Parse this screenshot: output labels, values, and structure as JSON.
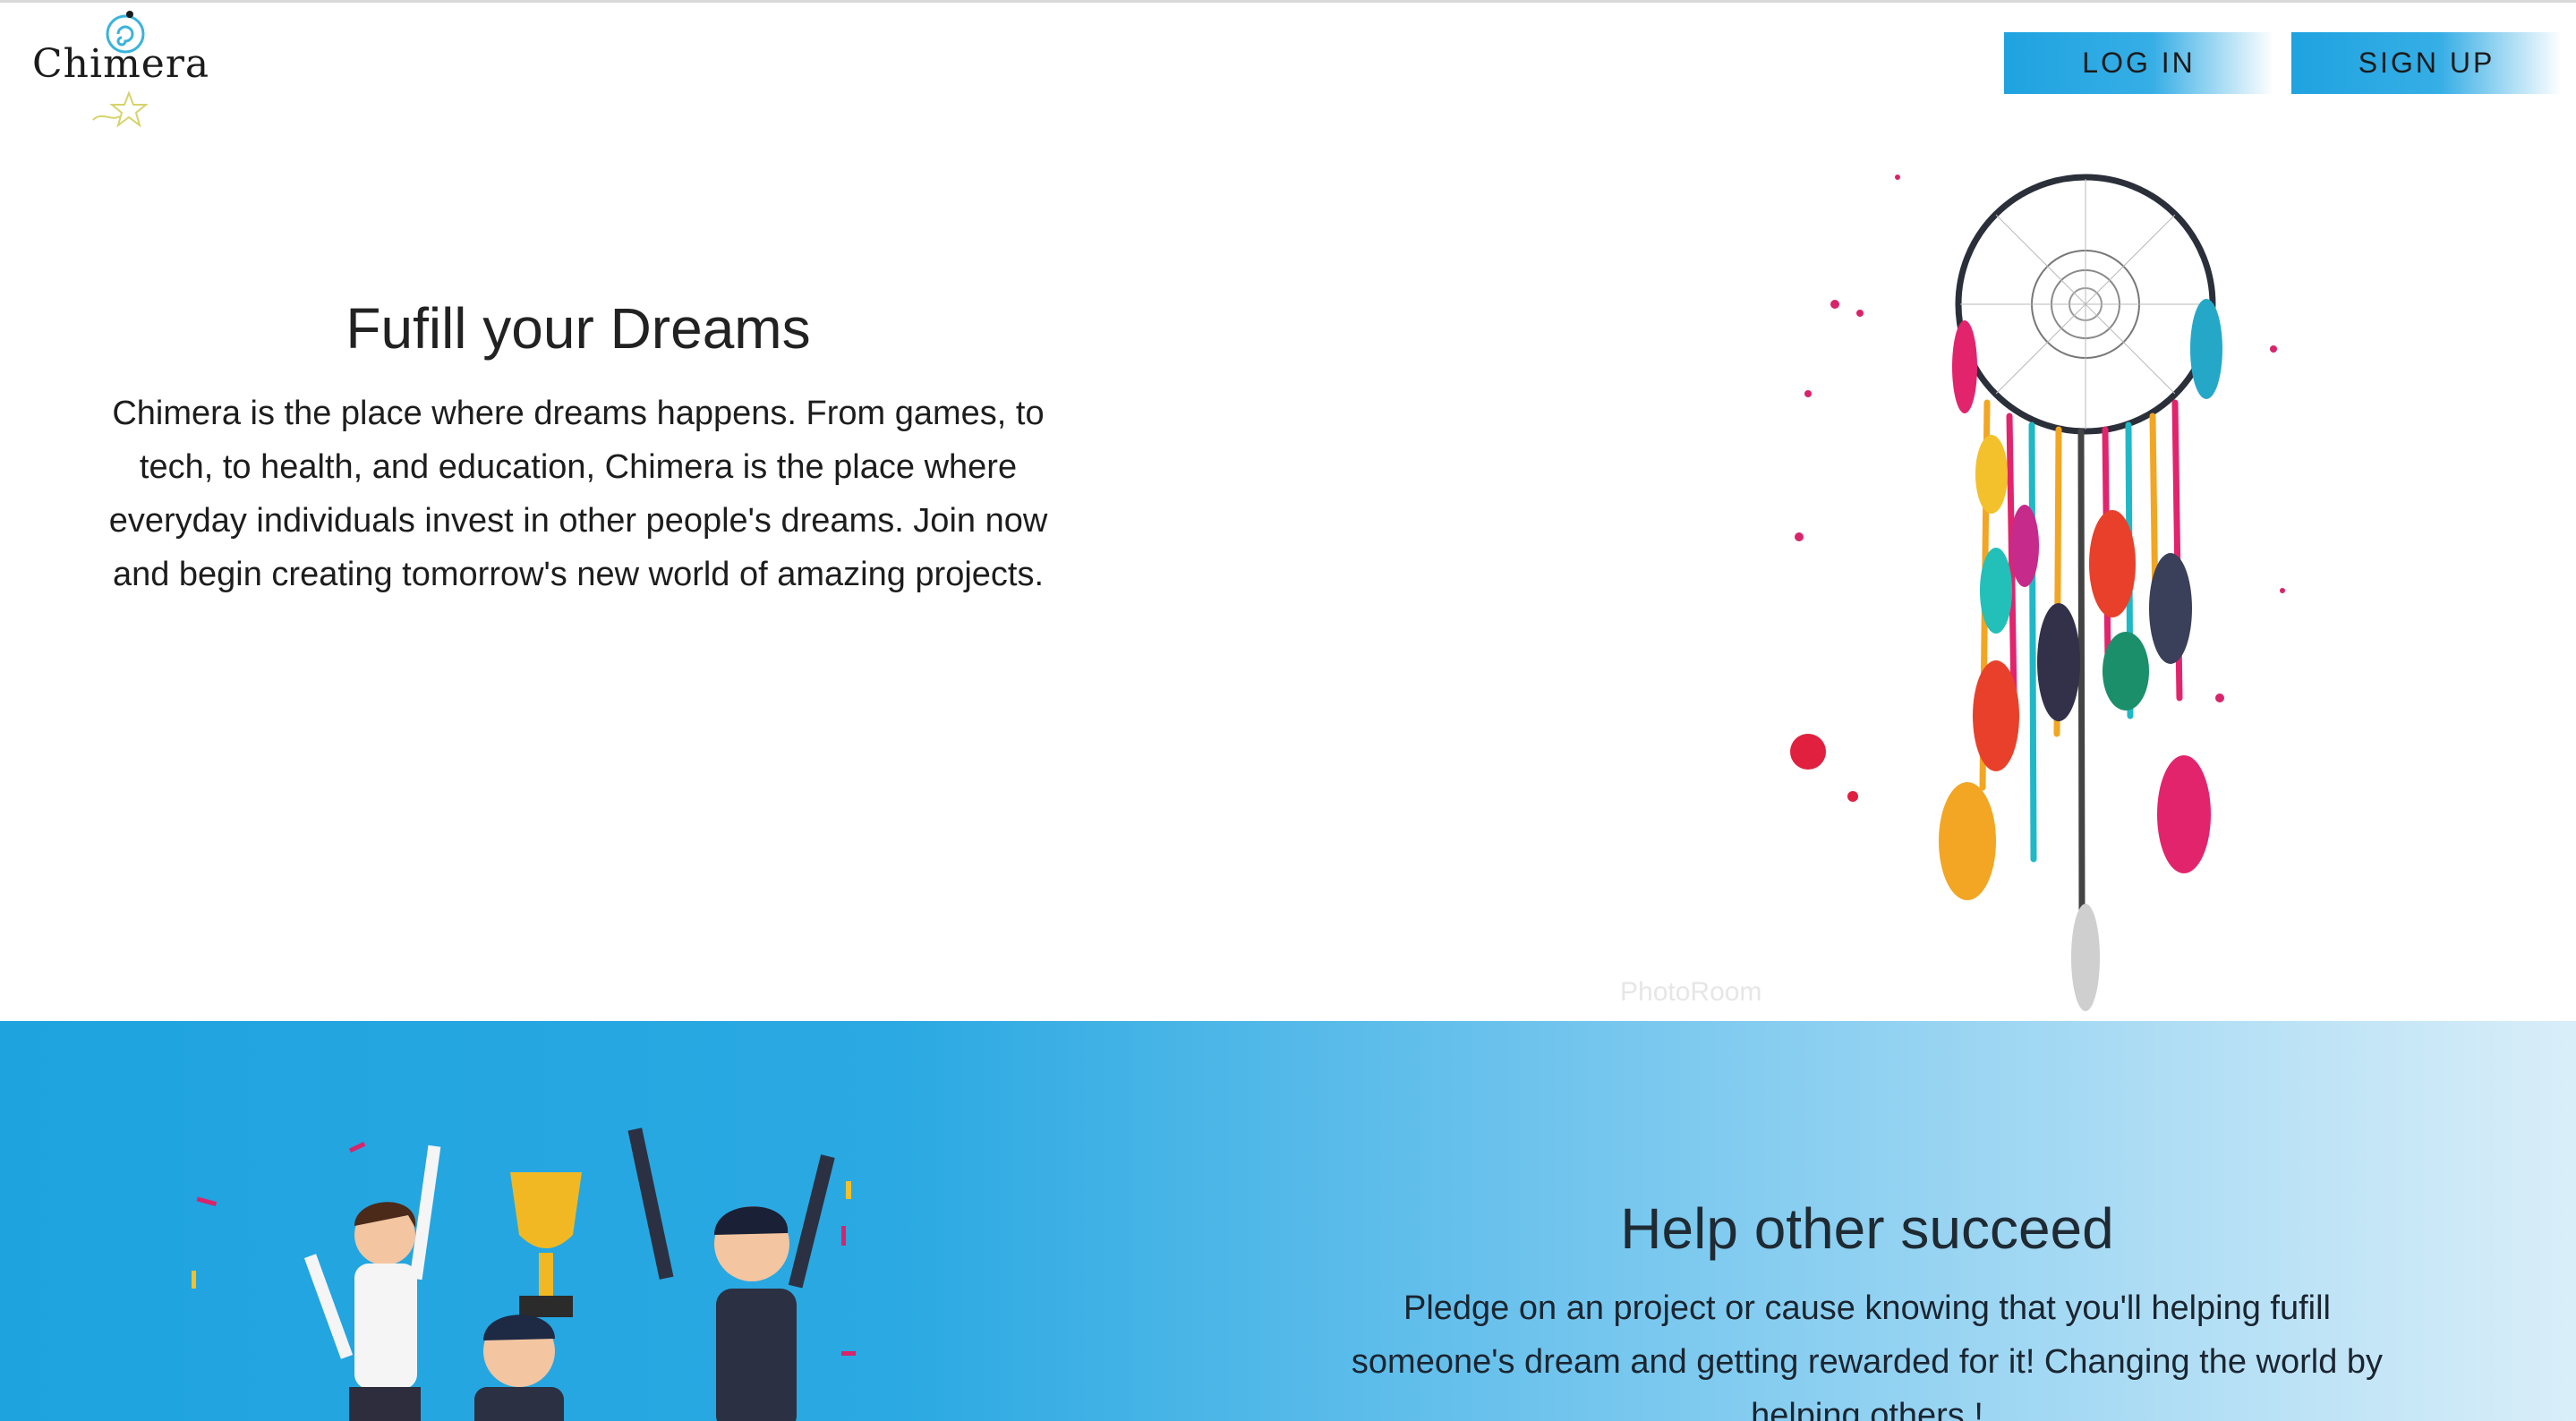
{
  "brand": {
    "name": "Chimera"
  },
  "header": {
    "login_label": "LOG IN",
    "signup_label": "SIGN UP"
  },
  "hero": {
    "title": "Fufill your Dreams",
    "text": "Chimera is the place where dreams happens. From games, to tech, to health, and education, Chimera is the place where everyday individuals invest in other people's dreams. Join now and begin creating tomorrow's new world of amazing projects.",
    "image": "dreamcatcher-illustration",
    "watermark": "PhotoRoom"
  },
  "help_section": {
    "title": "Help other succeed",
    "text": "Pledge on an project or cause knowing that you'll helping fufill someone's dream and getting rewarded for it! Changing the world by helping others !",
    "image": "celebrating-team-with-trophy-illustration"
  },
  "colors": {
    "accent": "#1fa3e0",
    "band_start": "#1ea3df",
    "band_end": "#d9eef9"
  },
  "icons": {
    "logo_swirl": "swirl-icon",
    "logo_star": "star-icon"
  }
}
